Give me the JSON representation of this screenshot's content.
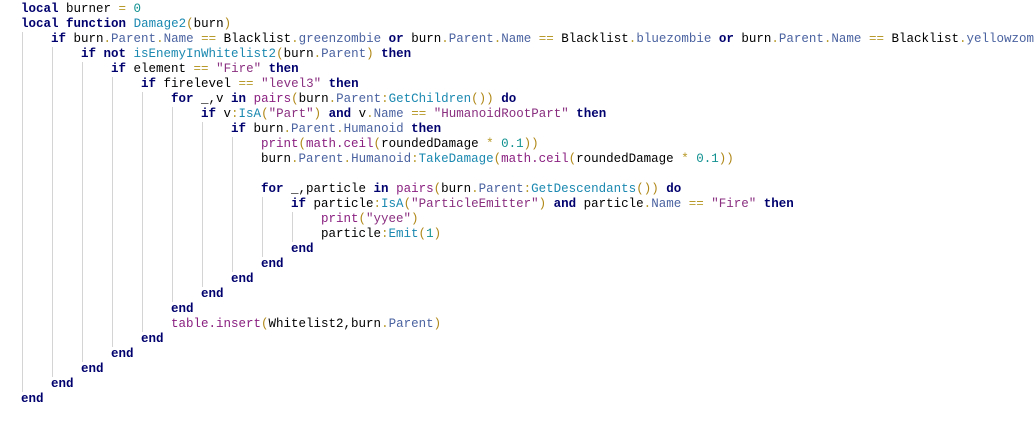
{
  "code": [
    {
      "indent": 0,
      "tokens": [
        [
          "kw",
          "local"
        ],
        [
          "id",
          " burner "
        ],
        [
          "op",
          "="
        ],
        [
          "num",
          " 0"
        ]
      ]
    },
    {
      "indent": 0,
      "tokens": [
        [
          "kw",
          "local"
        ],
        [
          "id",
          " "
        ],
        [
          "kw",
          "function"
        ],
        [
          "id",
          " "
        ],
        [
          "meth",
          "Damage2"
        ],
        [
          "pn",
          "("
        ],
        [
          "id",
          "burn"
        ],
        [
          "pn",
          ")"
        ]
      ]
    },
    {
      "indent": 1,
      "tokens": [
        [
          "kw",
          "if"
        ],
        [
          "id",
          " burn"
        ],
        [
          "op",
          "."
        ],
        [
          "prop",
          "Parent"
        ],
        [
          "op",
          "."
        ],
        [
          "prop",
          "Name"
        ],
        [
          "op",
          " == "
        ],
        [
          "id",
          "Blacklist"
        ],
        [
          "op",
          "."
        ],
        [
          "prop",
          "greenzombie"
        ],
        [
          "id",
          " "
        ],
        [
          "kw",
          "or"
        ],
        [
          "id",
          " burn"
        ],
        [
          "op",
          "."
        ],
        [
          "prop",
          "Parent"
        ],
        [
          "op",
          "."
        ],
        [
          "prop",
          "Name"
        ],
        [
          "op",
          " == "
        ],
        [
          "id",
          "Blacklist"
        ],
        [
          "op",
          "."
        ],
        [
          "prop",
          "bluezombie"
        ],
        [
          "id",
          " "
        ],
        [
          "kw",
          "or"
        ],
        [
          "id",
          " burn"
        ],
        [
          "op",
          "."
        ],
        [
          "prop",
          "Parent"
        ],
        [
          "op",
          "."
        ],
        [
          "prop",
          "Name"
        ],
        [
          "op",
          " == "
        ],
        [
          "id",
          "Blacklist"
        ],
        [
          "op",
          "."
        ],
        [
          "prop",
          "yellowzombie"
        ]
      ]
    },
    {
      "indent": 2,
      "tokens": [
        [
          "kw",
          "if not"
        ],
        [
          "id",
          " "
        ],
        [
          "meth",
          "isEnemyInWhitelist2"
        ],
        [
          "pn",
          "("
        ],
        [
          "id",
          "burn"
        ],
        [
          "op",
          "."
        ],
        [
          "prop",
          "Parent"
        ],
        [
          "pn",
          ")"
        ],
        [
          "id",
          " "
        ],
        [
          "kw",
          "then"
        ]
      ]
    },
    {
      "indent": 3,
      "tokens": [
        [
          "kw",
          "if"
        ],
        [
          "id",
          " element "
        ],
        [
          "op",
          "=="
        ],
        [
          "id",
          " "
        ],
        [
          "str",
          "\"Fire\""
        ],
        [
          "id",
          " "
        ],
        [
          "kw",
          "then"
        ]
      ]
    },
    {
      "indent": 4,
      "tokens": [
        [
          "kw",
          "if"
        ],
        [
          "id",
          " firelevel "
        ],
        [
          "op",
          "=="
        ],
        [
          "id",
          " "
        ],
        [
          "str",
          "\"level3\""
        ],
        [
          "id",
          " "
        ],
        [
          "kw",
          "then"
        ]
      ]
    },
    {
      "indent": 5,
      "tokens": [
        [
          "kw",
          "for"
        ],
        [
          "id",
          " _,v "
        ],
        [
          "kw",
          "in"
        ],
        [
          "id",
          " "
        ],
        [
          "fn",
          "pairs"
        ],
        [
          "pn",
          "("
        ],
        [
          "id",
          "burn"
        ],
        [
          "op",
          "."
        ],
        [
          "prop",
          "Parent"
        ],
        [
          "op",
          ":"
        ],
        [
          "meth",
          "GetChildren"
        ],
        [
          "pn",
          "())"
        ],
        [
          "id",
          " "
        ],
        [
          "kw",
          "do"
        ]
      ]
    },
    {
      "indent": 6,
      "tokens": [
        [
          "kw",
          "if"
        ],
        [
          "id",
          " v"
        ],
        [
          "op",
          ":"
        ],
        [
          "meth",
          "IsA"
        ],
        [
          "pn",
          "("
        ],
        [
          "str",
          "\"Part\""
        ],
        [
          "pn",
          ")"
        ],
        [
          "id",
          " "
        ],
        [
          "kw",
          "and"
        ],
        [
          "id",
          " v"
        ],
        [
          "op",
          "."
        ],
        [
          "prop",
          "Name"
        ],
        [
          "op",
          " == "
        ],
        [
          "str",
          "\"HumanoidRootPart\""
        ],
        [
          "id",
          " "
        ],
        [
          "kw",
          "then"
        ]
      ]
    },
    {
      "indent": 7,
      "tokens": [
        [
          "kw",
          "if"
        ],
        [
          "id",
          " burn"
        ],
        [
          "op",
          "."
        ],
        [
          "prop",
          "Parent"
        ],
        [
          "op",
          "."
        ],
        [
          "prop",
          "Humanoid"
        ],
        [
          "id",
          " "
        ],
        [
          "kw",
          "then"
        ]
      ]
    },
    {
      "indent": 8,
      "tokens": [
        [
          "fn",
          "print"
        ],
        [
          "pn",
          "("
        ],
        [
          "fn",
          "math.ceil"
        ],
        [
          "pn",
          "("
        ],
        [
          "id",
          "roundedDamage "
        ],
        [
          "op",
          "*"
        ],
        [
          "num",
          " 0.1"
        ],
        [
          "pn",
          "))"
        ]
      ]
    },
    {
      "indent": 8,
      "tokens": [
        [
          "id",
          "burn"
        ],
        [
          "op",
          "."
        ],
        [
          "prop",
          "Parent"
        ],
        [
          "op",
          "."
        ],
        [
          "prop",
          "Humanoid"
        ],
        [
          "op",
          ":"
        ],
        [
          "meth",
          "TakeDamage"
        ],
        [
          "pn",
          "("
        ],
        [
          "fn",
          "math.ceil"
        ],
        [
          "pn",
          "("
        ],
        [
          "id",
          "roundedDamage "
        ],
        [
          "op",
          "*"
        ],
        [
          "num",
          " 0.1"
        ],
        [
          "pn",
          "))"
        ]
      ]
    },
    {
      "indent": 8,
      "tokens": []
    },
    {
      "indent": 8,
      "tokens": [
        [
          "kw",
          "for"
        ],
        [
          "id",
          " _,particle "
        ],
        [
          "kw",
          "in"
        ],
        [
          "id",
          " "
        ],
        [
          "fn",
          "pairs"
        ],
        [
          "pn",
          "("
        ],
        [
          "id",
          "burn"
        ],
        [
          "op",
          "."
        ],
        [
          "prop",
          "Parent"
        ],
        [
          "op",
          ":"
        ],
        [
          "meth",
          "GetDescendants"
        ],
        [
          "pn",
          "())"
        ],
        [
          "id",
          " "
        ],
        [
          "kw",
          "do"
        ]
      ]
    },
    {
      "indent": 9,
      "tokens": [
        [
          "kw",
          "if"
        ],
        [
          "id",
          " particle"
        ],
        [
          "op",
          ":"
        ],
        [
          "meth",
          "IsA"
        ],
        [
          "pn",
          "("
        ],
        [
          "str",
          "\"ParticleEmitter\""
        ],
        [
          "pn",
          ")"
        ],
        [
          "id",
          " "
        ],
        [
          "kw",
          "and"
        ],
        [
          "id",
          " particle"
        ],
        [
          "op",
          "."
        ],
        [
          "prop",
          "Name"
        ],
        [
          "op",
          " == "
        ],
        [
          "str",
          "\"Fire\""
        ],
        [
          "id",
          " "
        ],
        [
          "kw",
          "then"
        ]
      ]
    },
    {
      "indent": 10,
      "tokens": [
        [
          "fn",
          "print"
        ],
        [
          "pn",
          "("
        ],
        [
          "str",
          "\"yyee\""
        ],
        [
          "pn",
          ")"
        ]
      ]
    },
    {
      "indent": 10,
      "tokens": [
        [
          "id",
          "particle"
        ],
        [
          "op",
          ":"
        ],
        [
          "meth",
          "Emit"
        ],
        [
          "pn",
          "("
        ],
        [
          "num",
          "1"
        ],
        [
          "pn",
          ")"
        ]
      ]
    },
    {
      "indent": 9,
      "tokens": [
        [
          "kw",
          "end"
        ]
      ]
    },
    {
      "indent": 8,
      "tokens": [
        [
          "kw",
          "end"
        ]
      ]
    },
    {
      "indent": 7,
      "tokens": [
        [
          "kw",
          "end"
        ]
      ]
    },
    {
      "indent": 6,
      "tokens": [
        [
          "kw",
          "end"
        ]
      ]
    },
    {
      "indent": 5,
      "tokens": [
        [
          "kw",
          "end"
        ]
      ]
    },
    {
      "indent": 5,
      "tokens": [
        [
          "fn",
          "table.insert"
        ],
        [
          "pn",
          "("
        ],
        [
          "id",
          "Whitelist2,burn"
        ],
        [
          "op",
          "."
        ],
        [
          "prop",
          "Parent"
        ],
        [
          "pn",
          ")"
        ]
      ]
    },
    {
      "indent": 4,
      "tokens": [
        [
          "kw",
          "end"
        ]
      ]
    },
    {
      "indent": 3,
      "tokens": [
        [
          "kw",
          "end"
        ]
      ]
    },
    {
      "indent": 2,
      "tokens": [
        [
          "kw",
          "end"
        ]
      ]
    },
    {
      "indent": 1,
      "tokens": [
        [
          "kw",
          "end"
        ]
      ]
    },
    {
      "indent": 0,
      "tokens": [
        [
          "kw",
          "end"
        ]
      ]
    }
  ]
}
